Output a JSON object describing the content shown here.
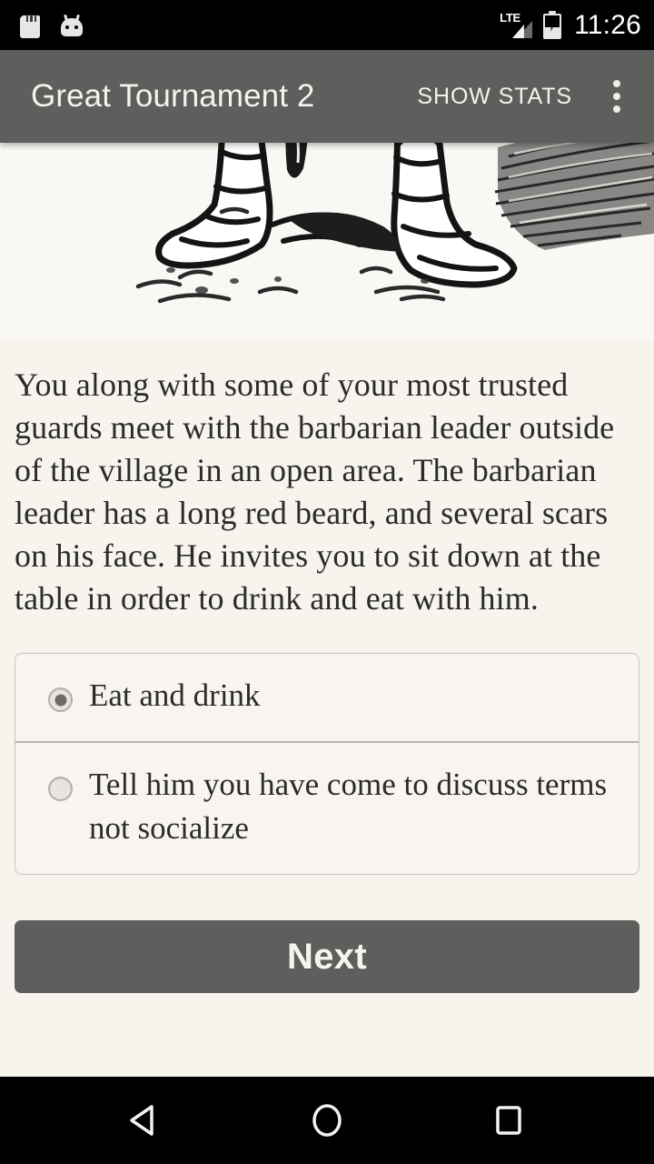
{
  "status_bar": {
    "icons": [
      "sd-card-icon",
      "android-head-icon"
    ],
    "network_label": "LTE",
    "signal_icon": "signal-bars-icon",
    "battery_icon": "battery-charging-icon",
    "time": "11:26"
  },
  "app_bar": {
    "title": "Great Tournament 2",
    "action_label": "SHOW STATS",
    "overflow_icon": "more-vertical-icon"
  },
  "illustration": {
    "alt": "black and white line drawing of boots standing on the ground"
  },
  "story": {
    "paragraph": "You along with some of your most trusted guards meet with the barbarian leader outside of the village in an open area. The barbarian leader has a long red beard, and several scars on his face. He invites you to sit down at the table in order to drink and eat with him."
  },
  "choices": [
    {
      "label": "Eat and drink",
      "selected": true
    },
    {
      "label": "Tell him you have come to discuss terms not socialize",
      "selected": false
    }
  ],
  "next_button": {
    "label": "Next"
  },
  "nav_bar": {
    "back_icon": "back-triangle-icon",
    "home_icon": "home-circle-icon",
    "recents_icon": "recents-square-icon"
  },
  "colors": {
    "app_bar": "#5e5e5c",
    "background": "#f7f4ee",
    "text": "#2b2b2b",
    "button": "#5e5e5c",
    "system_bar": "#000000"
  }
}
